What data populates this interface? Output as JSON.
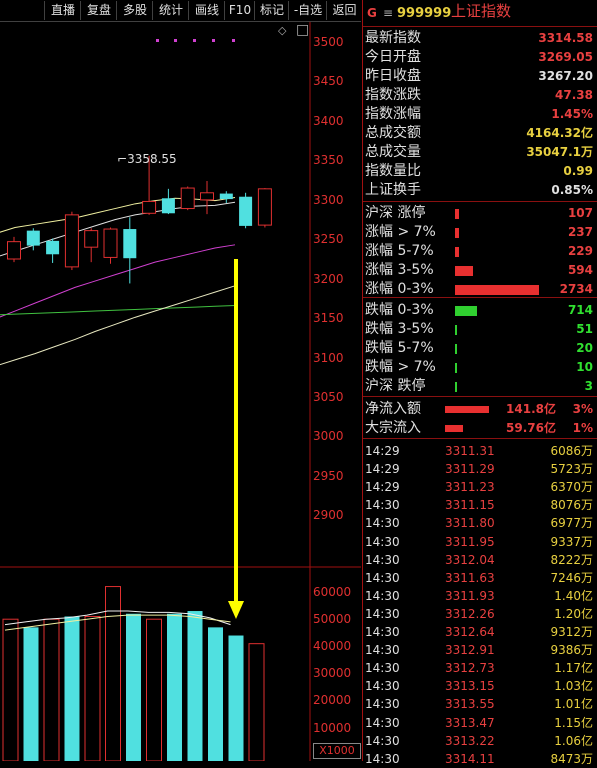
{
  "toolbar": {
    "buttons": [
      "直播",
      "复盘",
      "多股",
      "统计",
      "画线",
      "F10",
      "标记",
      "-自选",
      "返回"
    ]
  },
  "price_axis": [
    "3500",
    "3450",
    "3400",
    "3350",
    "3300",
    "3250",
    "3200",
    "3150",
    "3100",
    "3050",
    "3000",
    "2950",
    "2900"
  ],
  "volume_axis": [
    "60000",
    "50000",
    "40000",
    "30000",
    "20000",
    "10000"
  ],
  "volume_unit": "X1000",
  "high_marker": "3358.55",
  "header": {
    "prefix": "G",
    "menu_icon": "≡",
    "code": "999999",
    "name": "上证指数"
  },
  "stats": [
    {
      "label": "最新指数",
      "value": "3314.58",
      "color": "#e84040"
    },
    {
      "label": "今日开盘",
      "value": "3269.05",
      "color": "#e84040"
    },
    {
      "label": "昨日收盘",
      "value": "3267.20",
      "color": "#e0e0e0"
    },
    {
      "label": "指数涨跌",
      "value": "47.38",
      "color": "#e84040"
    },
    {
      "label": "指数涨幅",
      "value": "1.45%",
      "color": "#e84040"
    },
    {
      "label": "总成交额",
      "value": "4164.32亿",
      "color": "#e8d040"
    },
    {
      "label": "总成交量",
      "value": "35047.1万",
      "color": "#e8d040"
    },
    {
      "label": "指数量比",
      "value": "0.99",
      "color": "#e8d040"
    },
    {
      "label": "上证换手",
      "value": "0.85%",
      "color": "#e0e0e0"
    }
  ],
  "breadth_up": [
    {
      "label": "沪深 涨停",
      "value": "107",
      "bar": 0.02
    },
    {
      "label": "涨幅 > 7%",
      "value": "237",
      "bar": 0.03
    },
    {
      "label": "涨幅 5-7%",
      "value": "229",
      "bar": 0.03
    },
    {
      "label": "涨幅 3-5%",
      "value": "594",
      "bar": 0.22
    },
    {
      "label": "涨幅 0-3%",
      "value": "2734",
      "bar": 1.0
    }
  ],
  "breadth_down": [
    {
      "label": "跌幅 0-3%",
      "value": "714",
      "bar": 0.26
    },
    {
      "label": "跌幅 3-5%",
      "value": "51",
      "bar": 0.02
    },
    {
      "label": "跌幅 5-7%",
      "value": "20",
      "bar": 0.01
    },
    {
      "label": "跌幅 > 7%",
      "value": "10",
      "bar": 0.005
    },
    {
      "label": "沪深 跌停",
      "value": "3",
      "bar": 0.004
    }
  ],
  "flows": [
    {
      "label": "净流入额",
      "value": "141.8亿",
      "pct": "3%",
      "bar": 1.0
    },
    {
      "label": "大宗流入",
      "value": "59.76亿",
      "pct": "1%",
      "bar": 0.42
    }
  ],
  "ticks": [
    {
      "time": "14:29",
      "price": "3311.31",
      "vol": "6086万"
    },
    {
      "time": "14:29",
      "price": "3311.29",
      "vol": "5723万"
    },
    {
      "time": "14:29",
      "price": "3311.23",
      "vol": "6370万"
    },
    {
      "time": "14:30",
      "price": "3311.15",
      "vol": "8076万"
    },
    {
      "time": "14:30",
      "price": "3311.80",
      "vol": "6977万"
    },
    {
      "time": "14:30",
      "price": "3311.95",
      "vol": "9337万"
    },
    {
      "time": "14:30",
      "price": "3312.04",
      "vol": "8222万"
    },
    {
      "time": "14:30",
      "price": "3311.63",
      "vol": "7246万"
    },
    {
      "time": "14:30",
      "price": "3311.93",
      "vol": "1.40亿"
    },
    {
      "time": "14:30",
      "price": "3312.26",
      "vol": "1.20亿"
    },
    {
      "time": "14:30",
      "price": "3312.64",
      "vol": "9312万"
    },
    {
      "time": "14:30",
      "price": "3312.91",
      "vol": "9386万"
    },
    {
      "time": "14:30",
      "price": "3312.73",
      "vol": "1.17亿"
    },
    {
      "time": "14:30",
      "price": "3313.15",
      "vol": "1.03亿"
    },
    {
      "time": "14:30",
      "price": "3313.55",
      "vol": "1.01亿"
    },
    {
      "time": "14:30",
      "price": "3313.47",
      "vol": "1.15亿"
    },
    {
      "time": "14:30",
      "price": "3313.22",
      "vol": "1.06亿"
    },
    {
      "time": "14:30",
      "price": "3314.11",
      "vol": "8473万"
    }
  ],
  "chart_data": {
    "type": "candlestick",
    "price_ylim": [
      2860,
      3520
    ],
    "candles": [
      {
        "open": 3226,
        "close": 3248,
        "high": 3254,
        "low": 3222
      },
      {
        "open": 3262,
        "close": 3243,
        "high": 3265,
        "low": 3237
      },
      {
        "open": 3249,
        "close": 3232,
        "high": 3252,
        "low": 3221
      },
      {
        "open": 3216,
        "close": 3282,
        "high": 3286,
        "low": 3212
      },
      {
        "open": 3241,
        "close": 3262,
        "high": 3265,
        "low": 3222
      },
      {
        "open": 3228,
        "close": 3264,
        "high": 3266,
        "low": 3220
      },
      {
        "open": 3264,
        "close": 3227,
        "high": 3279,
        "low": 3195
      },
      {
        "open": 3284,
        "close": 3299,
        "high": 3357,
        "low": 3282
      },
      {
        "open": 3303,
        "close": 3284,
        "high": 3315,
        "low": 3283
      },
      {
        "open": 3290,
        "close": 3316,
        "high": 3318,
        "low": 3288
      },
      {
        "open": 3301,
        "close": 3310,
        "high": 3325,
        "low": 3283
      },
      {
        "open": 3309,
        "close": 3302,
        "high": 3312,
        "low": 3297
      },
      {
        "open": 3305,
        "close": 3268,
        "high": 3310,
        "low": 3265
      },
      {
        "open": 3269,
        "close": 3315,
        "high": 3316,
        "low": 3266
      }
    ],
    "volume_ylim": [
      0,
      66000
    ],
    "volumes": [
      {
        "value": 50000,
        "up": true
      },
      {
        "value": 47000,
        "up": false
      },
      {
        "value": 50000,
        "up": true
      },
      {
        "value": 51000,
        "up": false
      },
      {
        "value": 51000,
        "up": true
      },
      {
        "value": 62000,
        "up": true
      },
      {
        "value": 52000,
        "up": false
      },
      {
        "value": 50000,
        "up": true
      },
      {
        "value": 52000,
        "up": false
      },
      {
        "value": 53000,
        "up": false
      },
      {
        "value": 47000,
        "up": false
      },
      {
        "value": 44000,
        "up": false
      },
      {
        "value": 41000,
        "up": true
      }
    ],
    "ma_lines": [
      {
        "color": "#f0f0a0",
        "values": [
          3258,
          3266,
          3270,
          3274,
          3278,
          3284,
          3290,
          3296,
          3300,
          3303,
          3302,
          3300,
          3304
        ]
      },
      {
        "color": "#e0e0e0",
        "values": [
          3228,
          3236,
          3244,
          3252,
          3260,
          3268,
          3276,
          3282,
          3286,
          3290,
          3293,
          3294,
          3298
        ]
      },
      {
        "color": "#d040d0",
        "values": [
          3150,
          3160,
          3170,
          3180,
          3190,
          3198,
          3206,
          3214,
          3222,
          3228,
          3234,
          3240,
          3244
        ]
      },
      {
        "color": "#40c040",
        "values": [
          3155,
          3156,
          3157,
          3158,
          3159,
          3160,
          3161,
          3162,
          3163,
          3164,
          3165,
          3166,
          3167
        ]
      },
      {
        "color": "#e8e8c0",
        "values": [
          3090,
          3098,
          3106,
          3115,
          3124,
          3134,
          3143,
          3152,
          3160,
          3168,
          3176,
          3184,
          3192
        ]
      }
    ]
  },
  "colors": {
    "up": "#e03030",
    "down": "#50e0e0",
    "arrow": "#ffff00",
    "accent": "#e84040"
  }
}
